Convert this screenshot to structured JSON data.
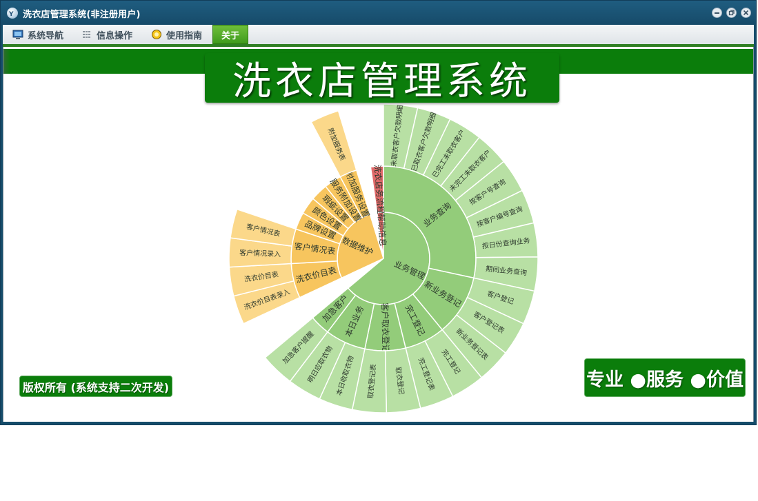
{
  "window": {
    "title": "洗衣店管理系统(非注册用户)",
    "icon": "app-logo-icon"
  },
  "menu": [
    {
      "label": "系统导航",
      "icon": "monitor-icon",
      "active": false
    },
    {
      "label": "信息操作",
      "icon": "grid-icon",
      "active": false
    },
    {
      "label": "使用指南",
      "icon": "light-bulb-icon",
      "active": false
    },
    {
      "label": "关于",
      "icon": "",
      "active": true
    }
  ],
  "banner": {
    "title": "洗衣店管理系统"
  },
  "footer": {
    "copyright": "版权所有 (系统支持二次开发)",
    "slogan": "专业 ●服务 ●价值"
  },
  "colors": {
    "brand_green": "#0b7d0b",
    "title_blue": "#164a68",
    "sector_green_dark": "#93cc7a",
    "sector_green_light": "#b8e0a4",
    "sector_orange_dark": "#f7c55e",
    "sector_orange_light": "#fbd88a",
    "sector_red": "#e06a6a"
  },
  "chart_data": {
    "type": "sunburst",
    "title": "",
    "center_label": "",
    "nodes": [
      {
        "name": "业务管理",
        "children": [
          {
            "name": "业务查询",
            "children": [
              {
                "name": "未取衣客户欠款明细",
                "children": []
              },
              {
                "name": "已取衣客户欠款明细",
                "children": []
              },
              {
                "name": "已完工未取衣客户",
                "children": []
              },
              {
                "name": "未完工未取衣客户",
                "children": []
              },
              {
                "name": "按客户号查询",
                "children": []
              },
              {
                "name": "按客户编号查询",
                "children": []
              },
              {
                "name": "按日份查询业务",
                "children": []
              },
              {
                "name": "期间业务查询",
                "children": []
              }
            ]
          },
          {
            "name": "新业务登记",
            "children": [
              {
                "name": "客户登记",
                "children": []
              },
              {
                "name": "客户登记表",
                "children": []
              },
              {
                "name": "新业务登记表",
                "children": []
              }
            ]
          },
          {
            "name": "完工登记",
            "children": [
              {
                "name": "完工登记",
                "children": []
              },
              {
                "name": "完工登记表",
                "children": []
              }
            ]
          },
          {
            "name": "客户取衣登记",
            "children": [
              {
                "name": "取衣登记",
                "children": []
              },
              {
                "name": "取衣登记表",
                "children": []
              }
            ]
          },
          {
            "name": "本日业务",
            "children": [
              {
                "name": "本日收取衣物",
                "children": []
              },
              {
                "name": "明日应取衣物",
                "children": []
              }
            ]
          },
          {
            "name": "加急客户",
            "children": [
              {
                "name": "加急客户提醒",
                "children": []
              }
            ]
          }
        ]
      },
      {
        "name": "帮助信息",
        "children": [
          {
            "name": "洗衣店务流程",
            "children": []
          }
        ]
      },
      {
        "name": "数据维护",
        "children": [
          {
            "name": "洗衣价目表",
            "children": [
              {
                "name": "洗衣价目表录入",
                "children": []
              },
              {
                "name": "洗衣价目表",
                "children": []
              }
            ]
          },
          {
            "name": "客户情况表",
            "children": [
              {
                "name": "客户情况录入",
                "children": []
              },
              {
                "name": "客户情况表",
                "children": []
              }
            ]
          },
          {
            "name": "品牌设置",
            "children": []
          },
          {
            "name": "颜色设置",
            "children": []
          },
          {
            "name": "瑕疵设置",
            "children": []
          },
          {
            "name": "服务附加设置",
            "children": []
          },
          {
            "name": "附加服务设置",
            "children": [
              {
                "name": "附加服务表",
                "children": []
              }
            ]
          }
        ]
      }
    ]
  }
}
